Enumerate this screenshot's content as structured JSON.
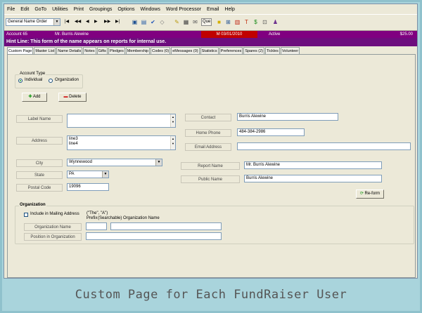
{
  "menu": [
    "File",
    "Edit",
    "GoTo",
    "Utilities",
    "Print",
    "Groupings",
    "Options",
    "Windows",
    "Word Processor",
    "Email",
    "Help"
  ],
  "toolbar": {
    "order_select": "General Name Order",
    "nav": [
      "|◀",
      "◀◀",
      "◀",
      "▶",
      "▶▶",
      "▶|"
    ],
    "query_label": "Que"
  },
  "status": {
    "account": "Account 65",
    "name": "Mr. Burris Alewine",
    "date": "M 03/01/2010",
    "state": "Active",
    "amount": "$25.00"
  },
  "hint": "Hint Line:  This form of the name appears on reports for internal use.",
  "tabs": [
    "Custom Page",
    "Master List",
    "Name Details",
    "Notes",
    "Gifts",
    "Pledges",
    "Membership",
    "Codes (0)",
    "eMessages (0)",
    "Statistics",
    "Preferences",
    "Spares (2)",
    "Tickles",
    "Volunteer"
  ],
  "form": {
    "account_type": {
      "title": "Account Type",
      "individual": "Individual",
      "organization": "Organization"
    },
    "add_label": "Add",
    "delete_label": "Delete",
    "label_name_btn": "Label Name",
    "address_btn": "Address",
    "address_lines": [
      "line3",
      "line4"
    ],
    "city_btn": "City",
    "city_value": "Wynnewood",
    "state_btn": "State",
    "state_value": "PA",
    "postal_btn": "Postal Code",
    "postal_value": "19096",
    "contact_btn": "Contact",
    "contact_value": "Burris Alewine",
    "home_phone_btn": "Home Phone",
    "home_phone_value": "484-384-2986",
    "email_btn": "Email Address",
    "email_value": "",
    "report_name_btn": "Report Name",
    "report_name_value": "Mr. Burris Alewine",
    "public_name_btn": "Public Name",
    "public_name_value": "Burris Alewine",
    "reform_label": "Re-form",
    "organization": {
      "title": "Organization",
      "include_label": "Include in Mailing Address",
      "prefix_hint": "(\"The\", \"A\")",
      "prefix_label": "Prefix",
      "searchable_label": "(Searchable) Organization Name",
      "org_name_btn": "Organization Name",
      "position_btn": "Position in Organization"
    }
  },
  "caption": "Custom Page for Each FundRaiser User"
}
